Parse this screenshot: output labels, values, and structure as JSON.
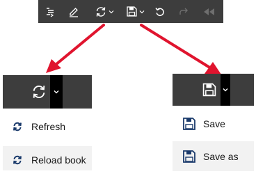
{
  "toolbar": {
    "buttons": [
      {
        "name": "table-of-contents",
        "icon": "toc-icon"
      },
      {
        "name": "annotate",
        "icon": "pencil-icon"
      },
      {
        "name": "refresh",
        "icon": "refresh-icon",
        "has_caret": true
      },
      {
        "name": "save",
        "icon": "floppy-disk-icon",
        "has_caret": true
      },
      {
        "name": "undo",
        "icon": "undo-icon"
      },
      {
        "name": "redo",
        "icon": "redo-icon",
        "disabled": true
      },
      {
        "name": "rewind",
        "icon": "rewind-icon",
        "disabled": true
      }
    ]
  },
  "refresh_menu": {
    "items": [
      {
        "label": "Refresh",
        "icon": "refresh-icon"
      },
      {
        "label": "Reload book",
        "icon": "refresh-icon"
      }
    ]
  },
  "save_menu": {
    "items": [
      {
        "label": "Save",
        "icon": "floppy-disk-icon"
      },
      {
        "label": "Save as",
        "icon": "floppy-disk-icon"
      }
    ]
  },
  "colors": {
    "toolbar_bg": "#3d3d3d",
    "icon_fg": "#ffffff",
    "disabled_fg": "#6f6f6f",
    "arrow": "#e0142e",
    "menu_highlight": "#f2f2f2"
  }
}
